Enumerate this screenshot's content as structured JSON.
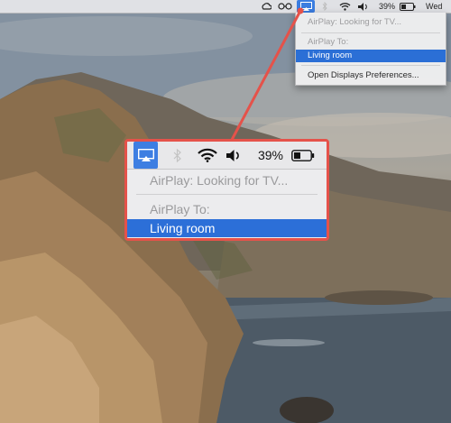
{
  "menubar": {
    "battery_percent": "39%",
    "clock_partial": "Wed"
  },
  "dropdown": {
    "status": "AirPlay: Looking for TV...",
    "section_label": "AirPlay To:",
    "selected_device": "Living room",
    "open_prefs": "Open Displays Preferences..."
  },
  "zoom": {
    "battery_percent": "39%",
    "status": "AirPlay: Looking for TV...",
    "section_label": "AirPlay To:",
    "selected_device": "Living room"
  },
  "colors": {
    "accent_blue": "#2b6fd6",
    "callout_red": "#e5524a"
  },
  "icons": [
    "creative-cloud-icon",
    "glasses-icon",
    "airplay-icon",
    "bluetooth-icon",
    "wifi-icon",
    "volume-icon",
    "battery-icon"
  ]
}
